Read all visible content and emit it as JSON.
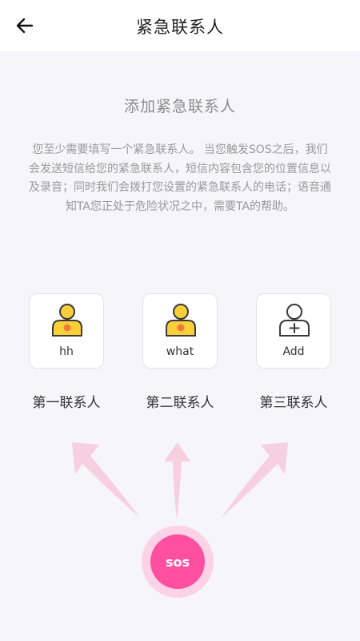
{
  "header": {
    "title": "紧急联系人"
  },
  "main": {
    "section_title": "添加紧急联系人",
    "description": "您至少需要填写一个紧急联系人。 当您触发SOS之后，我们会发送短信给您的紧急联系人，短信内容包含您的位置信息以及录音；同时我们会拨打您设置的紧急联系人的电话；语音通知TA您正处于危险状况之中，需要TA的帮助。",
    "contacts": [
      {
        "name": "hh",
        "label": "第一联系人",
        "icon": "person-filled-icon"
      },
      {
        "name": "what",
        "label": "第二联系人",
        "icon": "person-filled-icon"
      },
      {
        "name": "Add",
        "label": "第三联系人",
        "icon": "person-add-outline-icon"
      }
    ],
    "sos_label": "sos"
  },
  "colors": {
    "accent": "#ff4fa0",
    "avatar_yellow": "#f9cf3a",
    "avatar_dot": "#ee7a3c",
    "arrow_pink": "#f7d0df"
  }
}
